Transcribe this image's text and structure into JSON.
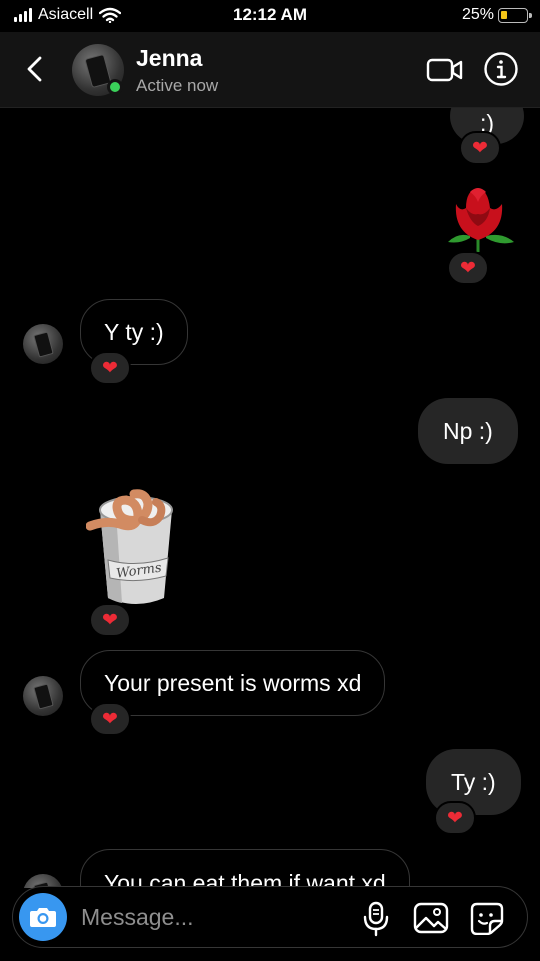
{
  "status_bar": {
    "carrier": "Asiacell",
    "time": "12:12 AM",
    "battery": "25%",
    "battery_level": 0.25
  },
  "header": {
    "name": "Jenna",
    "status": "Active now"
  },
  "messages": {
    "partial_top": {
      "text": ":)",
      "reaction": "❤"
    },
    "rose": {
      "reaction": "❤"
    },
    "m1": {
      "text": "Y ty :)",
      "reaction": "❤"
    },
    "m2": {
      "text": "Np :)"
    },
    "worms": {
      "label": "Worms",
      "reaction": "❤"
    },
    "m3": {
      "text": "Your present is worms xd",
      "reaction": "❤"
    },
    "m4": {
      "text": "Ty :)",
      "reaction": "❤"
    },
    "m5": {
      "text": "You can eat them if want xd"
    }
  },
  "composer": {
    "placeholder": "Message..."
  },
  "colors": {
    "online": "#3ad15a",
    "camera": "#3897f0",
    "heart": "#ed2b36",
    "outgoing_bubble": "#262626"
  }
}
